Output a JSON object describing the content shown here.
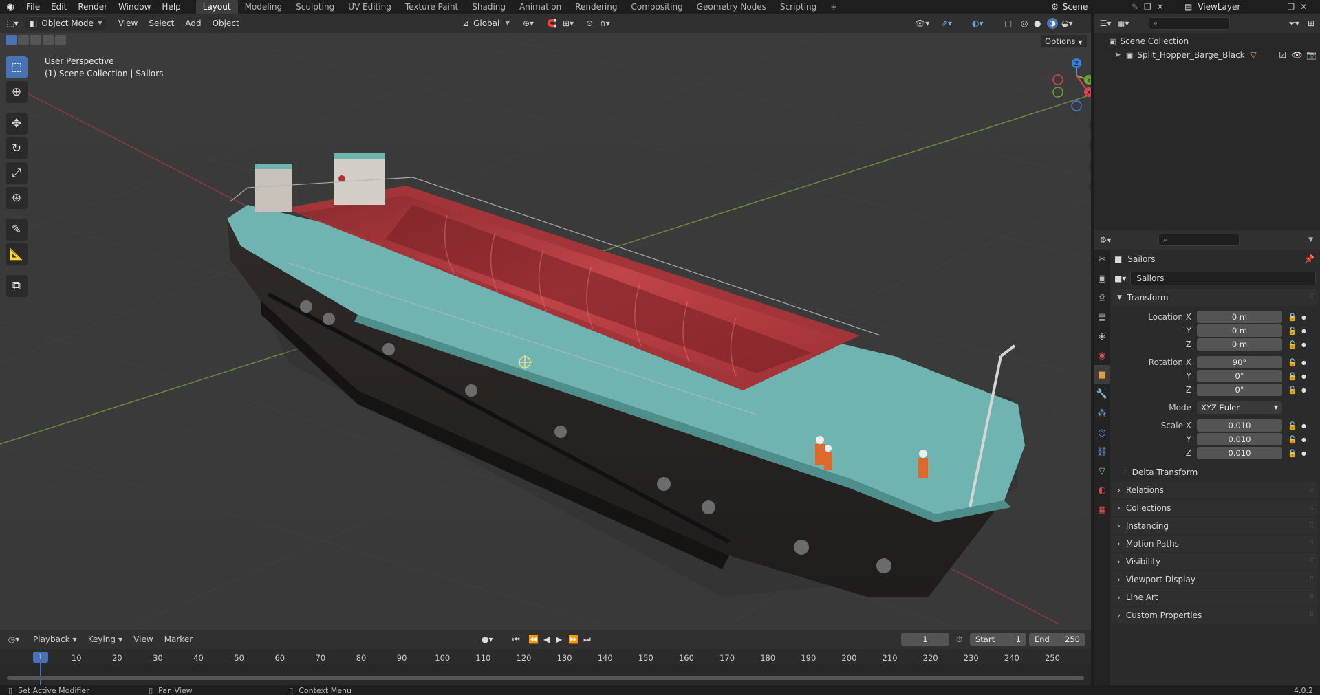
{
  "topbar": {
    "menus": [
      "File",
      "Edit",
      "Render",
      "Window",
      "Help"
    ],
    "workspaces": [
      "Layout",
      "Modeling",
      "Sculpting",
      "UV Editing",
      "Texture Paint",
      "Shading",
      "Animation",
      "Rendering",
      "Compositing",
      "Geometry Nodes",
      "Scripting"
    ],
    "active_workspace": "Layout",
    "add_workspace": "+",
    "scene": "Scene",
    "view_layer": "ViewLayer"
  },
  "viewport_header": {
    "mode": "Object Mode",
    "menus": [
      "View",
      "Select",
      "Add",
      "Object"
    ],
    "orientation": "Global",
    "options": "Options"
  },
  "viewport": {
    "perspective": "User Perspective",
    "context": "(1) Scene Collection | Sailors",
    "gizmo_axes": [
      "Z",
      "Y",
      "X"
    ]
  },
  "outliner": {
    "root": "Scene Collection",
    "items": [
      {
        "name": "Split_Hopper_Barge_Black"
      }
    ]
  },
  "properties": {
    "object_name": "Sailors",
    "data_name": "Sailors",
    "transform": {
      "title": "Transform",
      "location_label": "Location X",
      "location": [
        "0 m",
        "0 m",
        "0 m"
      ],
      "rotation_label": "Rotation X",
      "rotation": [
        "90°",
        "0°",
        "0°"
      ],
      "mode_label": "Mode",
      "mode": "XYZ Euler",
      "scale_label": "Scale X",
      "scale": [
        "0.010",
        "0.010",
        "0.010"
      ],
      "y": "Y",
      "z": "Z",
      "delta": "Delta Transform"
    },
    "panels": [
      "Relations",
      "Collections",
      "Instancing",
      "Motion Paths",
      "Visibility",
      "Viewport Display",
      "Line Art",
      "Custom Properties"
    ]
  },
  "timeline": {
    "menus": [
      "Playback",
      "Keying",
      "View",
      "Marker"
    ],
    "current_frame": "1",
    "start_label": "Start",
    "start": "1",
    "end_label": "End",
    "end": "250",
    "ticks": [
      "1",
      "10",
      "20",
      "30",
      "40",
      "50",
      "60",
      "70",
      "80",
      "90",
      "100",
      "110",
      "120",
      "130",
      "140",
      "150",
      "160",
      "170",
      "180",
      "190",
      "200",
      "210",
      "220",
      "230",
      "240",
      "250"
    ]
  },
  "statusbar": {
    "left": "Set Active Modifier",
    "middle": "Pan View",
    "right": "Context Menu",
    "version": "4.0.2"
  },
  "colors": {
    "accent": "#4772b3",
    "hull": "#2a2624",
    "hold": "#b03a3c",
    "deck": "#6fb4b0",
    "grid_x": "#8a3a3a",
    "grid_y": "#6a8a3a"
  }
}
